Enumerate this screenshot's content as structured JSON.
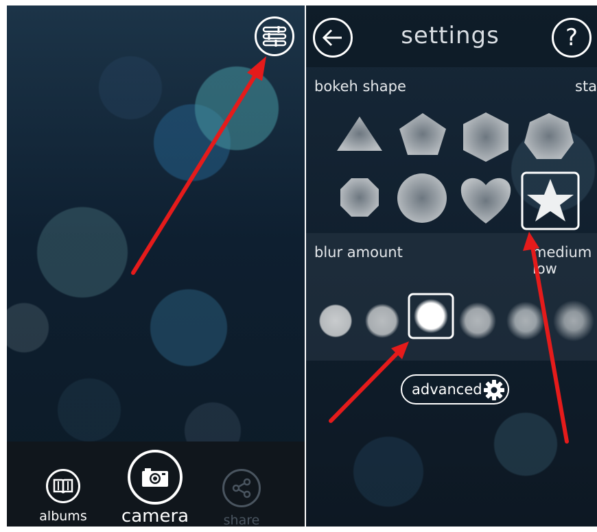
{
  "left_screen": {
    "nav": [
      {
        "id": "albums",
        "label": "albums",
        "icon": "book-icon"
      },
      {
        "id": "camera",
        "label": "camera",
        "icon": "camera-icon"
      },
      {
        "id": "share",
        "label": "share",
        "icon": "share-icon"
      }
    ],
    "settings_icon": "sliders-icon"
  },
  "right_screen": {
    "title": "settings",
    "back_icon": "back-arrow-icon",
    "help_icon": "help-icon",
    "bokeh": {
      "label": "bokeh shape",
      "value": "star",
      "shapes": [
        "triangle",
        "pentagon",
        "hexagon",
        "heptagon",
        "octagon",
        "circle",
        "heart",
        "star"
      ],
      "selected": "star"
    },
    "blur": {
      "label": "blur amount",
      "value": "medium low",
      "levels": 6,
      "selected_index": 2
    },
    "advanced_label": "advanced",
    "advanced_icon": "gear-icon"
  },
  "colors": {
    "annotation_arrow": "#e51b1b",
    "text": "#ffffff"
  }
}
